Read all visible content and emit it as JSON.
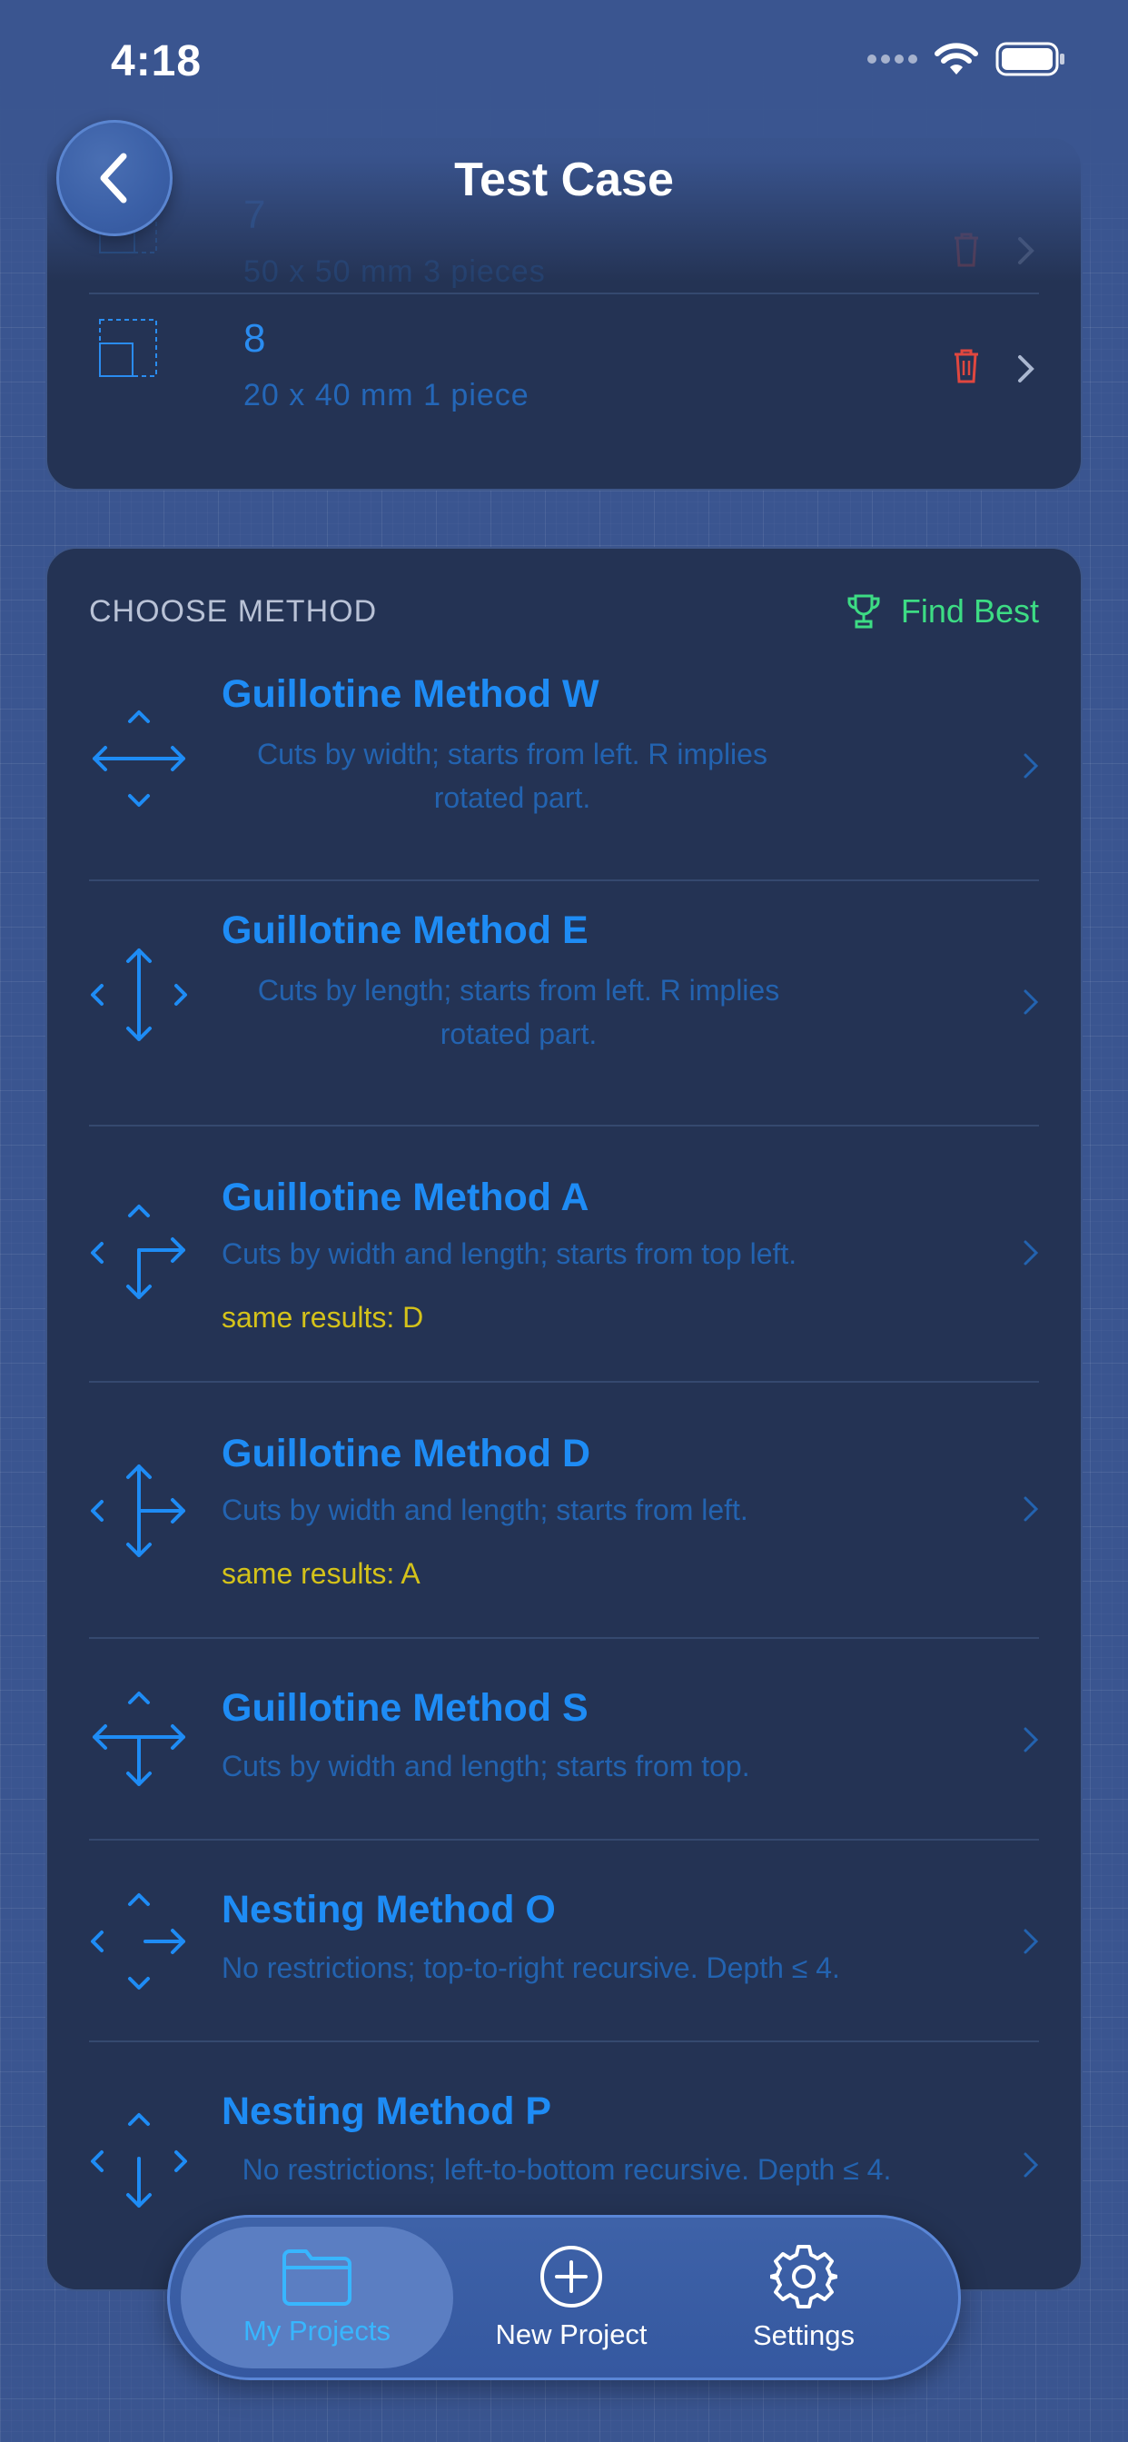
{
  "status_bar": {
    "time": "4:18"
  },
  "header": {
    "title": "Test Case"
  },
  "pieces": [
    {
      "name": "7",
      "dims": "50 x 50 mm  3 pieces"
    },
    {
      "name": "8",
      "dims": "20 x 40 mm  1 piece"
    }
  ],
  "methods_section": {
    "heading": "CHOOSE METHOD",
    "find_best": "Find Best",
    "items": [
      {
        "title": "Guillotine Method W",
        "desc": "Cuts by width; starts from left. R implies rotated part.",
        "same": ""
      },
      {
        "title": "Guillotine Method E",
        "desc": "Cuts by length; starts from left. R implies rotated part.",
        "same": ""
      },
      {
        "title": "Guillotine Method A",
        "desc": "Cuts by width and length; starts from top left.",
        "same": "same results: D"
      },
      {
        "title": "Guillotine Method D",
        "desc": "Cuts by width and length; starts from left.",
        "same": "same results: A"
      },
      {
        "title": "Guillotine Method S",
        "desc": "Cuts by width and length; starts from top.",
        "same": ""
      },
      {
        "title": "Nesting Method O",
        "desc": "No restrictions; top-to-right recursive. Depth ≤ 4.",
        "same": ""
      },
      {
        "title": "Nesting Method P",
        "desc": "No restrictions; left-to-bottom recursive. Depth ≤ 4.",
        "same": ""
      }
    ]
  },
  "tabbar": {
    "tabs": [
      {
        "label": "My Projects",
        "icon": "folder-icon",
        "active": true
      },
      {
        "label": "New Project",
        "icon": "plus-circle-icon",
        "active": false
      },
      {
        "label": "Settings",
        "icon": "gear-icon",
        "active": false
      }
    ]
  },
  "colors": {
    "background": "#3a5590",
    "card": "#243354",
    "accent_blue": "#1e8cf5",
    "find_best_green": "#3ddc84",
    "same_results_yellow": "#d4c21a",
    "delete_red": "#e0473f"
  }
}
